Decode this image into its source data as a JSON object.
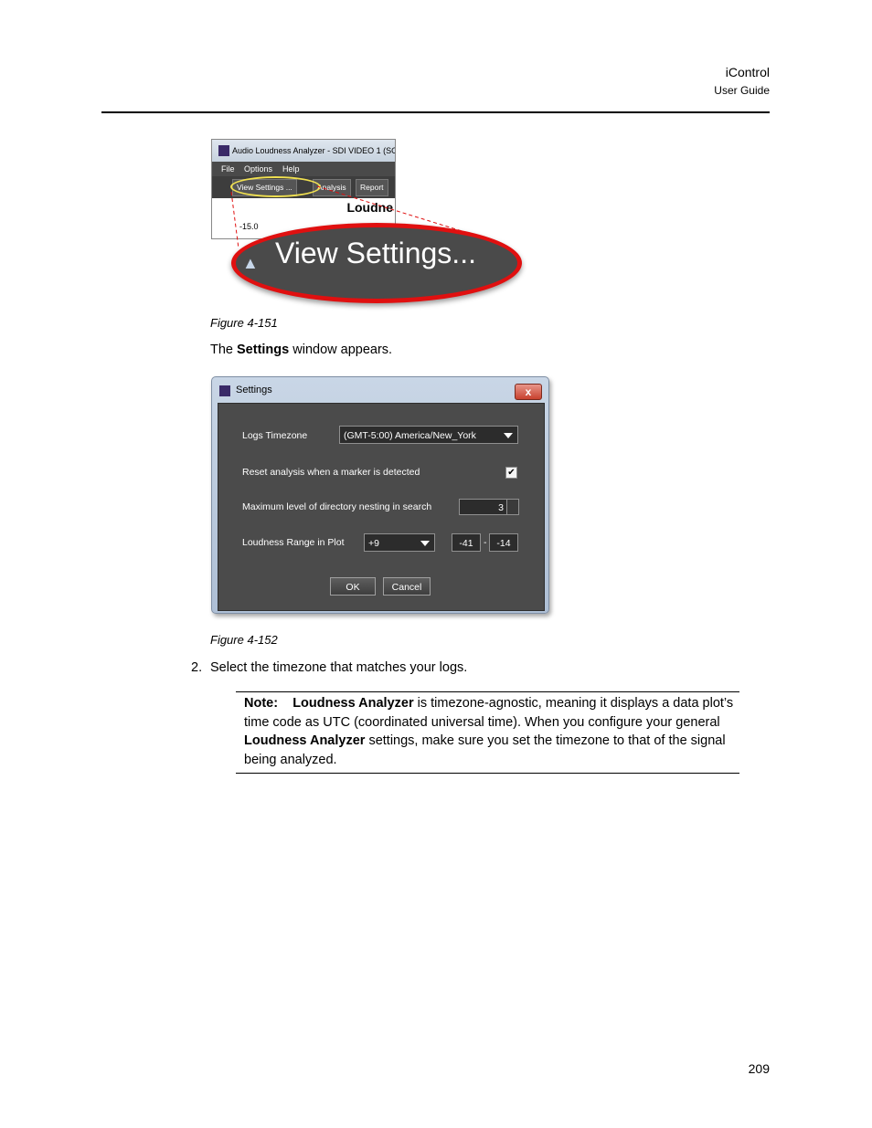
{
  "header": {
    "title": "iControl",
    "subtitle": "User Guide"
  },
  "figure1": {
    "window_title": "Audio Loudness Analyzer - SDI VIDEO 1 (SOI",
    "menu": [
      "File",
      "Options",
      "Help"
    ],
    "toolbar": [
      "View Settings ...",
      "Analysis",
      "Report"
    ],
    "plot_heading": "Loudne",
    "plot_tick": "-15.0",
    "zoom_label": "View Settings...",
    "caption": "Figure 4-151"
  },
  "text_after_fig1": {
    "pre": "The ",
    "bold": "Settings",
    "post": " window appears."
  },
  "settings_window": {
    "title": "Settings",
    "close": "x",
    "logs_timezone_label": "Logs Timezone",
    "logs_timezone_value": "(GMT-5:00) America/New_York",
    "reset_label": "Reset analysis when a marker is detected",
    "reset_checked": true,
    "reset_check_glyph": "✔",
    "nesting_label": "Maximum level of directory nesting in search",
    "nesting_value": "3",
    "range_label": "Loudness Range in Plot",
    "range_value": "+9",
    "range_low": "-41",
    "range_dash": "-",
    "range_high": "-14",
    "ok": "OK",
    "cancel": "Cancel"
  },
  "figure2_caption": "Figure 4-152",
  "step": {
    "number": "2.",
    "text": "Select the timezone that matches your logs."
  },
  "note": {
    "label": "Note:",
    "product": "Loudness Analyzer",
    "text1": " is timezone-agnostic, meaning it displays a data plot’s time code as UTC (coordinated universal time). When you configure your general ",
    "product2": "Loudness Analyzer",
    "text2": " settings, make sure you set the timezone to that of the signal being analyzed."
  },
  "page_number": "209"
}
